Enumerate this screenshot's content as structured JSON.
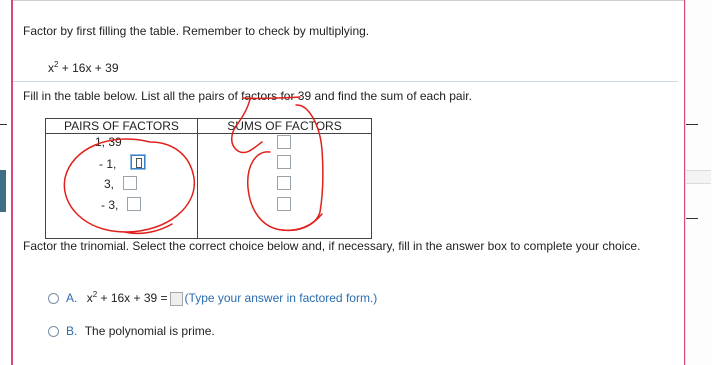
{
  "instructions": "Factor by first filling the table. Remember to check by multiplying.",
  "polynomial": {
    "x": "x",
    "exp": "2",
    "rest": " + 16x + 39"
  },
  "fill_prompt": "Fill in the table below. List all the pairs of factors for 39 and find the sum of each pair.",
  "table": {
    "headers": [
      "PAIRS OF FACTORS",
      "SUMS OF FACTORS"
    ],
    "pairs": [
      "1, 39",
      "- 1,",
      "3,",
      "- 3,"
    ]
  },
  "choice_prompt": "Factor the trinomial. Select the correct choice below and, if necessary, fill in the answer box to complete your choice.",
  "options": {
    "a": {
      "letter": "A.",
      "x": "x",
      "exp": "2",
      "expr_rest": " + 16x + 39 =",
      "hint": "(Type your answer in factored form.)"
    },
    "b": {
      "letter": "B.",
      "text": "The polynomial is prime."
    }
  },
  "colors": {
    "accent_pink": "#d64b7c",
    "link_blue": "#2a6db0",
    "annotation_red": "#e0201a",
    "sidebar_teal": "#3d6f87"
  }
}
